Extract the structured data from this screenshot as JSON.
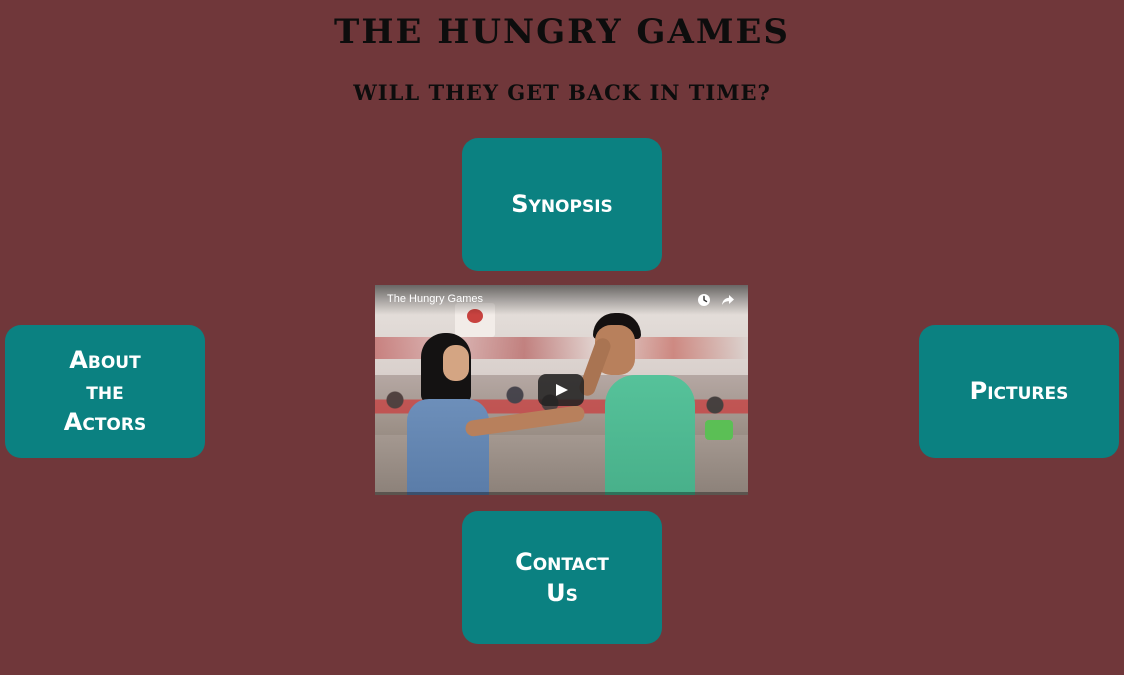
{
  "header": {
    "title": "THE HUNGRY GAMES",
    "subtitle": "WILL THEY GET BACK IN TIME?"
  },
  "nav": {
    "synopsis": "Synopsis",
    "about": [
      "About",
      "the",
      "Actors"
    ],
    "pictures": "Pictures",
    "contact": [
      "Contact",
      "Us"
    ]
  },
  "video": {
    "title": "The Hungry Games",
    "icons": [
      "watch-later-icon",
      "share-icon",
      "play-icon"
    ]
  },
  "colors": {
    "background": "#70373a",
    "button": "#0b8181",
    "button_text": "#ffffff",
    "heading_text": "#0d0d0d"
  }
}
